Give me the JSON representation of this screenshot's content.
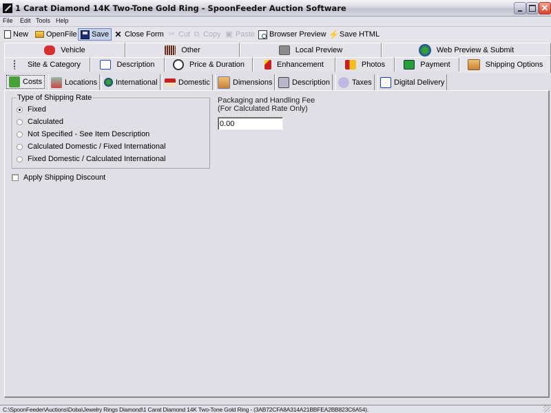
{
  "window": {
    "title": "1 Carat Diamond 14K Two-Tone Gold Ring - SpoonFeeder Auction Software",
    "controls": [
      "minimize",
      "maximize",
      "close"
    ]
  },
  "menu": {
    "items": [
      {
        "label": "File",
        "accel": "F"
      },
      {
        "label": "Edit",
        "accel": "E"
      },
      {
        "label": "Tools",
        "accel": "T"
      },
      {
        "label": "Help",
        "accel": "H"
      }
    ]
  },
  "toolbar": {
    "buttons": [
      {
        "label": "New",
        "icon": "new-document-icon",
        "state": "enabled"
      },
      {
        "label": "OpenFile",
        "icon": "open-folder-icon",
        "state": "enabled"
      },
      {
        "label": "Save",
        "icon": "floppy-disk-icon",
        "state": "active"
      },
      {
        "label": "Close Form",
        "icon": "close-x-icon",
        "state": "enabled"
      },
      {
        "label": "Cut",
        "icon": "scissors-icon",
        "state": "disabled"
      },
      {
        "label": "Copy",
        "icon": "copy-icon",
        "state": "disabled"
      },
      {
        "label": "Paste",
        "icon": "paste-icon",
        "state": "disabled"
      },
      {
        "label": "Browser Preview",
        "icon": "browser-preview-icon",
        "state": "enabled"
      },
      {
        "label": "Save HTML",
        "icon": "save-html-icon",
        "state": "enabled"
      }
    ]
  },
  "tabs": {
    "row1": [
      {
        "label": "Vehicle",
        "icon": "car-icon"
      },
      {
        "label": "Other",
        "icon": "barcode-icon"
      },
      {
        "label": "Local Preview",
        "icon": "monitor-icon"
      },
      {
        "label": "Web Preview & Submit",
        "icon": "globe-icon"
      }
    ],
    "row2": [
      {
        "label": "Site & Category",
        "icon": "tree-icon"
      },
      {
        "label": "Description",
        "icon": "notepad-icon"
      },
      {
        "label": "Price & Duration",
        "icon": "clock-icon"
      },
      {
        "label": "Enhancement",
        "icon": "magic-wand-icon"
      },
      {
        "label": "Photos",
        "icon": "film-icon"
      },
      {
        "label": "Payment",
        "icon": "payment-card-icon"
      },
      {
        "label": "Shipping Options",
        "icon": "package-icon",
        "selected": true
      }
    ],
    "subtabs": [
      {
        "label": "Costs",
        "icon": "money-icon",
        "selected": true
      },
      {
        "label": "Locations",
        "icon": "building-icon"
      },
      {
        "label": "International",
        "icon": "globe-icon"
      },
      {
        "label": "Domestic",
        "icon": "house-icon"
      },
      {
        "label": "Dimensions",
        "icon": "box-dimensions-icon"
      },
      {
        "label": "Description",
        "icon": "mailbox-icon"
      },
      {
        "label": "Taxes",
        "icon": "tax-icon"
      },
      {
        "label": "Digital Delivery",
        "icon": "digital-delivery-icon"
      }
    ]
  },
  "costs": {
    "rate_group_label": "Type of Shipping Rate",
    "rate_options": [
      {
        "label": "Fixed",
        "checked": true
      },
      {
        "label": "Calculated",
        "checked": false
      },
      {
        "label": "Not Specified - See Item Description",
        "checked": false
      },
      {
        "label": "Calculated Domestic / Fixed International",
        "checked": false
      },
      {
        "label": "Fixed Domestic / Calculated International",
        "checked": false
      }
    ],
    "apply_discount_label": "Apply Shipping Discount",
    "apply_discount_checked": false,
    "fee_label_line1": "Packaging and Handling Fee",
    "fee_label_line2": "(For Calculated Rate Only)",
    "fee_value": "0.00"
  },
  "status": {
    "text": "C:\\SpoonFeeder\\Auctions\\Doba\\Jewelry Rings Diamond\\1 Carat Diamond 14K Two-Tone Gold Ring - (3AB72CFA8A314A21BBFEA2BB823C6A54)."
  },
  "colors": {
    "titlebar": "#d0d0dc",
    "window_bg": "#e0dfe5",
    "active_button": "#c6d2ec",
    "close_button": "#d8442c"
  }
}
